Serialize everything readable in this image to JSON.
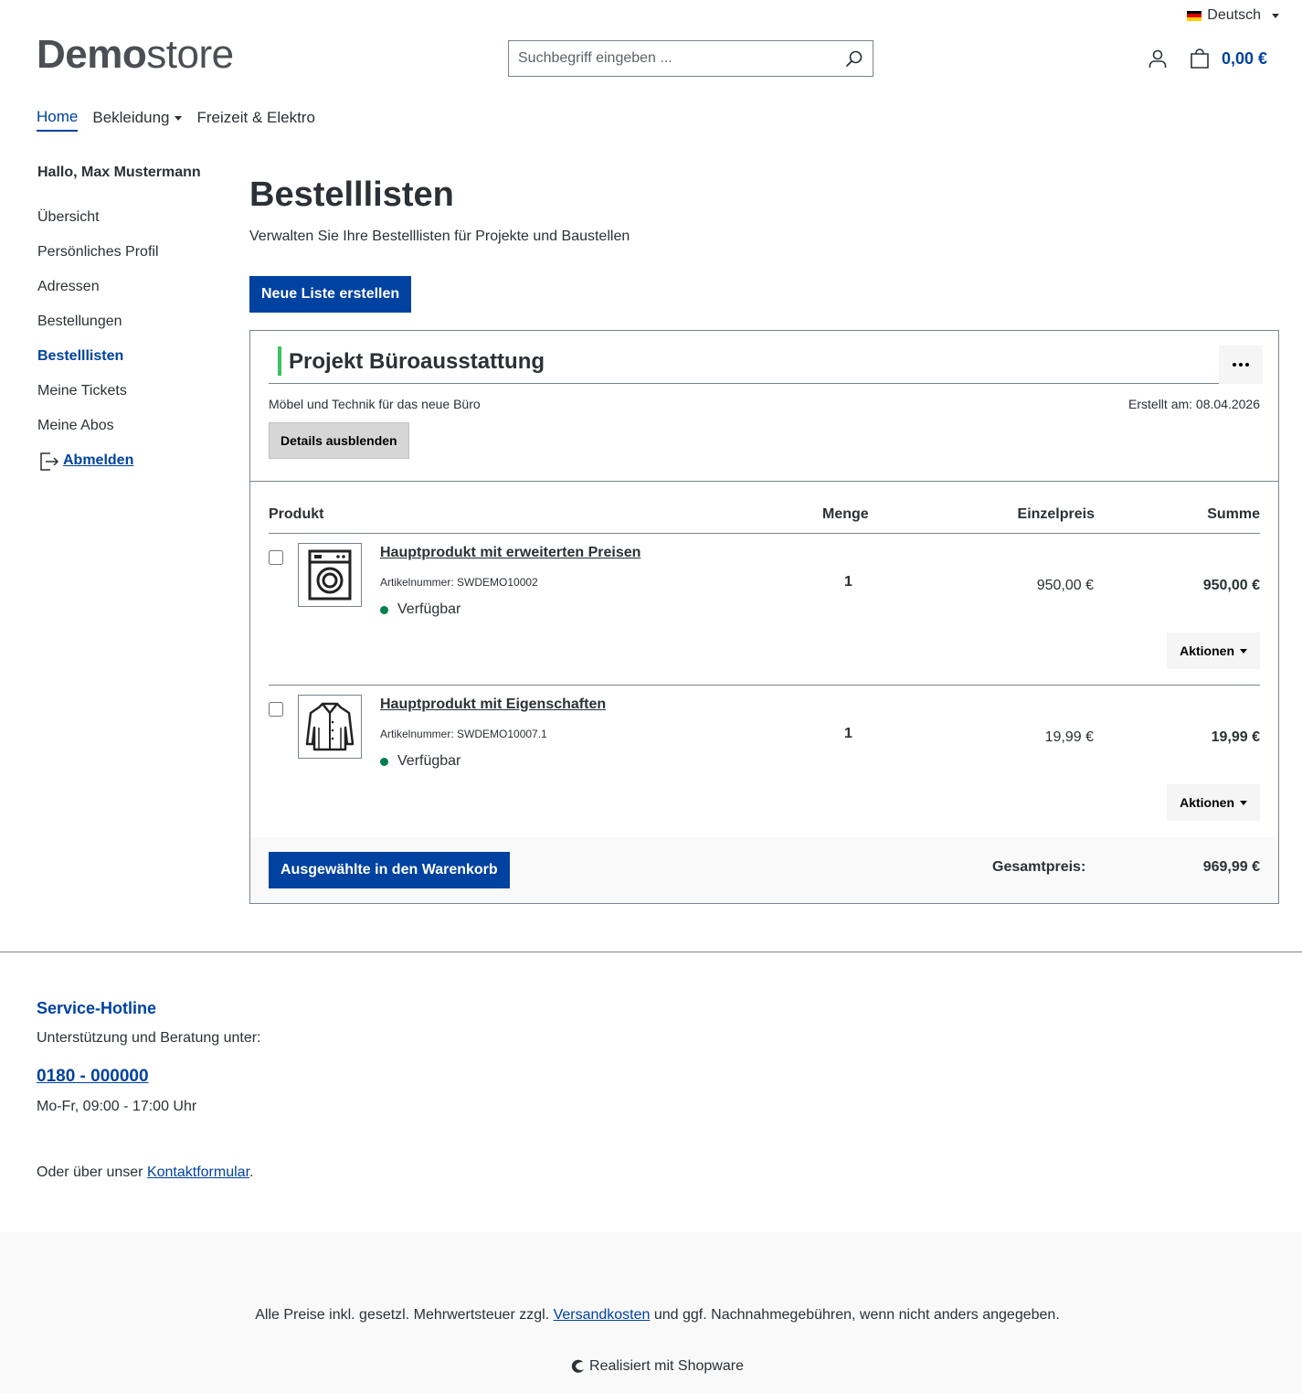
{
  "topbar": {
    "language": "Deutsch",
    "flag_colors": [
      "#000000",
      "#dd0000",
      "#ffce00"
    ]
  },
  "header": {
    "logo_bold": "Demo",
    "logo_light": "store",
    "search_placeholder": "Suchbegriff eingeben ...",
    "cart_total": "0,00 €"
  },
  "nav": {
    "home": "Home",
    "clothing": "Bekleidung",
    "leisure": "Freizeit & Elektro"
  },
  "sidebar": {
    "greeting": "Hallo, Max Mustermann",
    "items": [
      "Übersicht",
      "Persönliches Profil",
      "Adressen",
      "Bestellungen",
      "Bestelllisten",
      "Meine Tickets",
      "Meine Abos"
    ],
    "active_index": 4,
    "logout": "Abmelden"
  },
  "main": {
    "title": "Bestelllisten",
    "subtitle": "Verwalten Sie Ihre Bestelllisten für Projekte und Baustellen",
    "new_list_button": "Neue Liste erstellen"
  },
  "list": {
    "title": "Projekt Büroausstattung",
    "accent_color": "#3cc261",
    "description": "Möbel und Technik für das neue Büro",
    "created": "Erstellt am: 08.04.2026",
    "details_button": "Details ausblenden",
    "columns": {
      "product": "Produkt",
      "quantity": "Menge",
      "unit_price": "Einzelpreis",
      "sum": "Summe"
    },
    "items": [
      {
        "name": "Hauptprodukt mit erweiterten Preisen",
        "sku": "Artikelnummer: SWDEMO10002",
        "stock": "Verfügbar",
        "qty": "1",
        "unit_price": "950,00 €",
        "total": "950,00 €",
        "actions": "Aktionen",
        "icon": "washing-machine-icon"
      },
      {
        "name": "Hauptprodukt mit Eigenschaften",
        "sku": "Artikelnummer: SWDEMO10007.1",
        "stock": "Verfügbar",
        "qty": "1",
        "unit_price": "19,99 €",
        "total": "19,99 €",
        "actions": "Aktionen",
        "icon": "jacket-icon"
      }
    ],
    "add_to_cart_button": "Ausgewählte in den Warenkorb",
    "grand_total_label": "Gesamtpreis:",
    "grand_total_value": "969,99 €"
  },
  "footer": {
    "hotline_title": "Service-Hotline",
    "support_text": "Unterstützung und Beratung unter:",
    "phone": "0180 - 000000",
    "hours": "Mo-Fr, 09:00 - 17:00 Uhr",
    "contact_prefix": "Oder über unser ",
    "contact_link": "Kontaktformular",
    "contact_suffix": ".",
    "vat_prefix": "Alle Preise inkl. gesetzl. Mehrwertsteuer zzgl. ",
    "vat_link": "Versandkosten",
    "vat_suffix": " und ggf. Nachnahmegebühren, wenn nicht anders angegeben.",
    "powered": "Realisiert mit Shopware"
  },
  "colors": {
    "primary": "#0042a0",
    "text": "#2b3136",
    "available": "#007e4e"
  }
}
